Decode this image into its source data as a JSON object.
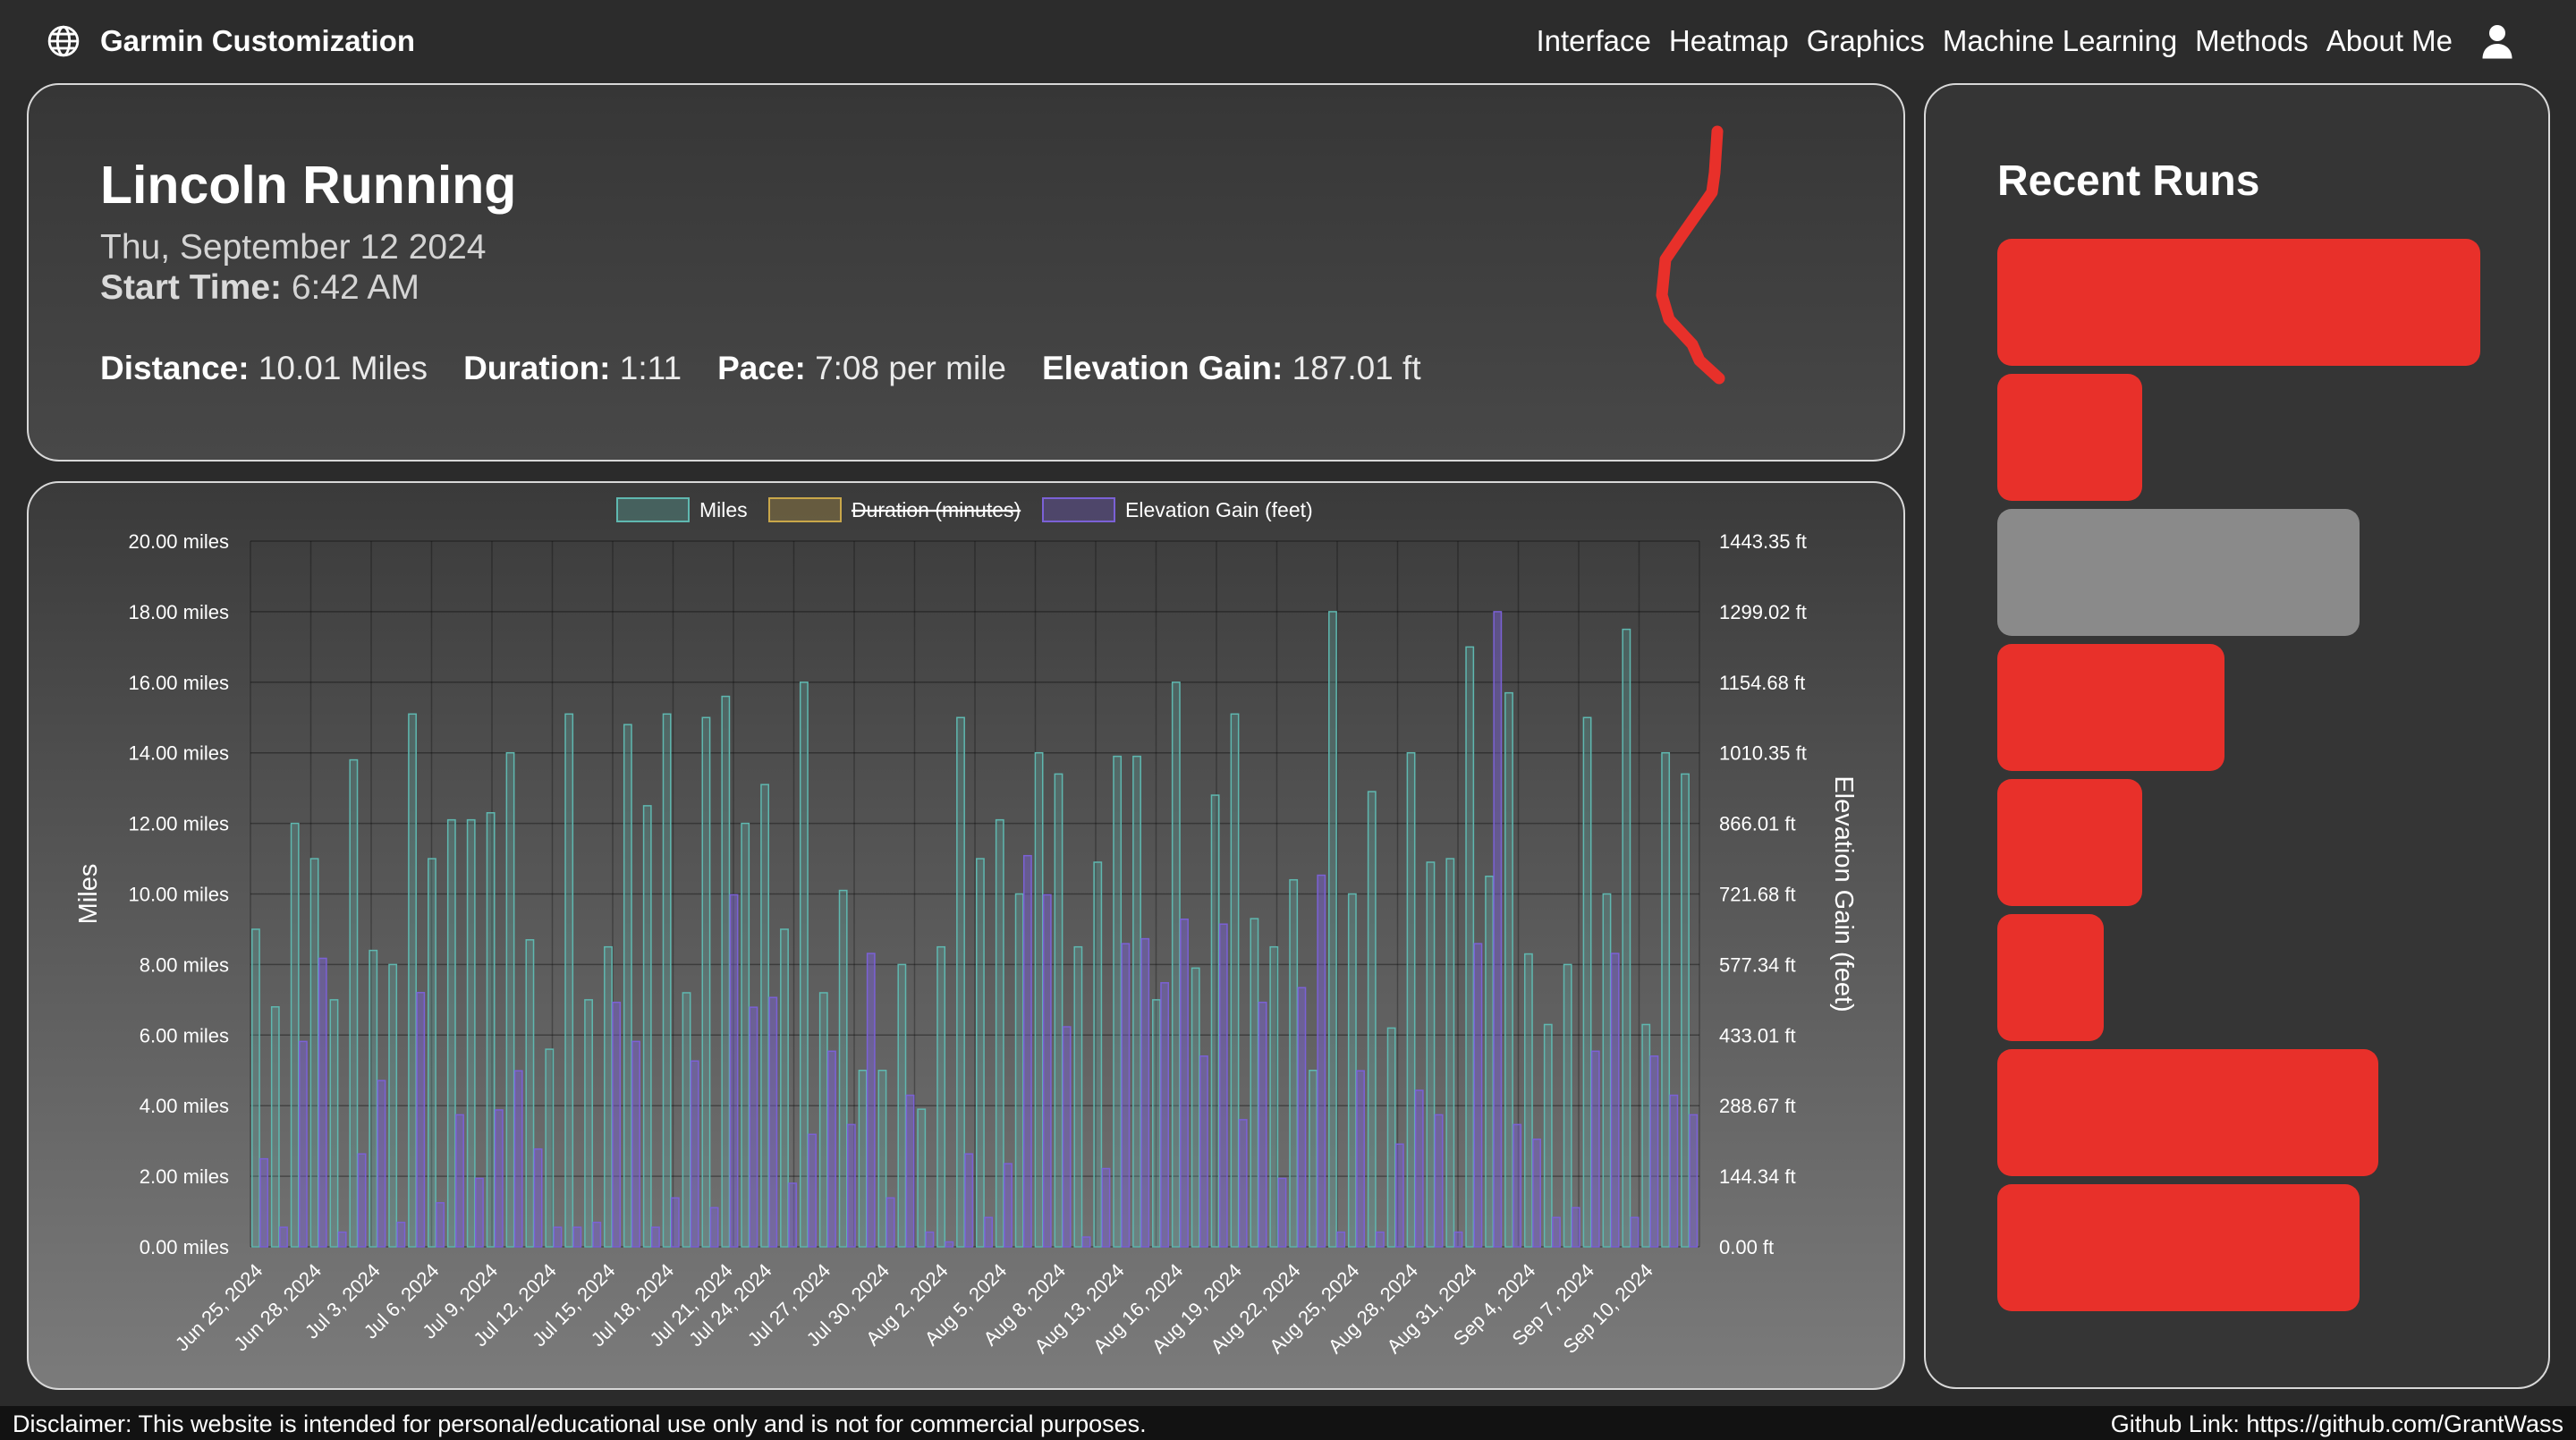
{
  "navbar": {
    "brand": "Garmin Customization",
    "links": [
      "Interface",
      "Heatmap",
      "Graphics",
      "Machine Learning",
      "Methods",
      "About Me"
    ]
  },
  "summary": {
    "title": "Lincoln Running",
    "date": "Thu, September 12 2024",
    "start_label": "Start Time:",
    "start_value": "6:42 AM",
    "distance_label": "Distance:",
    "distance_value": "10.01 Miles",
    "duration_label": "Duration:",
    "duration_value": "1:11",
    "pace_label": "Pace:",
    "pace_value": "7:08 per mile",
    "elev_label": "Elevation Gain:",
    "elev_value": "187.01 ft",
    "route_color": "#e8302a"
  },
  "recent_runs": {
    "title": "Recent Runs",
    "bars": [
      {
        "value": 10.01,
        "color": "#e8302a"
      },
      {
        "value": 3.0,
        "color": "#e8302a"
      },
      {
        "value": 7.5,
        "color": "#8a8a8a"
      },
      {
        "value": 4.7,
        "color": "#e8302a"
      },
      {
        "value": 3.0,
        "color": "#e8302a"
      },
      {
        "value": 2.2,
        "color": "#e8302a"
      },
      {
        "value": 7.9,
        "color": "#e8302a"
      },
      {
        "value": 7.5,
        "color": "#e8302a"
      }
    ]
  },
  "chart_data": {
    "type": "bar",
    "legend": [
      {
        "name": "Miles",
        "color": "#5fb8b0",
        "hidden": false
      },
      {
        "name": "Duration (minutes)",
        "color": "#c9a74a",
        "hidden": true
      },
      {
        "name": "Elevation Gain (feet)",
        "color": "#7b61d6",
        "hidden": false
      }
    ],
    "ylabel_left": "Miles",
    "ylabel_right": "Elevation Gain (feet)",
    "left_ticks": [
      "0.00 miles",
      "2.00 miles",
      "4.00 miles",
      "6.00 miles",
      "8.00 miles",
      "10.00 miles",
      "12.00 miles",
      "14.00 miles",
      "16.00 miles",
      "18.00 miles",
      "20.00 miles"
    ],
    "right_ticks": [
      "0.00 ft",
      "144.34 ft",
      "288.67 ft",
      "433.01 ft",
      "577.34 ft",
      "721.68 ft",
      "866.01 ft",
      "1010.35 ft",
      "1154.68 ft",
      "1299.02 ft",
      "1443.35 ft"
    ],
    "ylim_left": [
      0,
      20
    ],
    "ylim_right": [
      0,
      1443.35
    ],
    "x_labels": [
      "Jun 25, 2024",
      "Jun 28, 2024",
      "Jul 3, 2024",
      "Jul 6, 2024",
      "Jul 9, 2024",
      "Jul 12, 2024",
      "Jul 15, 2024",
      "Jul 18, 2024",
      "Jul 21, 2024",
      "Jul 24, 2024",
      "Jul 27, 2024",
      "Jul 30, 2024",
      "Aug 2, 2024",
      "Aug 5, 2024",
      "Aug 8, 2024",
      "Aug 13, 2024",
      "Aug 16, 2024",
      "Aug 19, 2024",
      "Aug 22, 2024",
      "Aug 25, 2024",
      "Aug 28, 2024",
      "Aug 31, 2024",
      "Sep 4, 2024",
      "Sep 7, 2024",
      "Sep 10, 2024"
    ],
    "miles": [
      9.0,
      6.8,
      12.0,
      11.0,
      7.0,
      13.8,
      8.4,
      8.0,
      15.1,
      11.0,
      12.1,
      12.1,
      12.3,
      14.0,
      8.7,
      5.6,
      15.1,
      7.0,
      8.5,
      14.8,
      12.5,
      15.1,
      7.2,
      15.0,
      15.6,
      12.0,
      13.1,
      9.0,
      16.0,
      7.2,
      10.1,
      5.0,
      5.0,
      8.0,
      3.9,
      8.5,
      15.0,
      11.0,
      12.1,
      10.0,
      14.0,
      13.4,
      8.5,
      10.9,
      13.9,
      13.9,
      7.0,
      16.0,
      7.9,
      12.8,
      15.1,
      9.3,
      8.5,
      10.4,
      5.0,
      18.0,
      10.0,
      12.9,
      6.2,
      14.0,
      10.9,
      11.0,
      17.0,
      10.5,
      15.7,
      8.3,
      6.3,
      8.0,
      15.0,
      10.0,
      17.5,
      6.3,
      14.0,
      13.4
    ],
    "elevation_ft": [
      180,
      40,
      420,
      590,
      30,
      190,
      340,
      50,
      520,
      90,
      270,
      140,
      280,
      360,
      200,
      40,
      40,
      50,
      500,
      420,
      40,
      100,
      380,
      80,
      720,
      490,
      510,
      130,
      230,
      400,
      250,
      600,
      100,
      310,
      30,
      10,
      190,
      60,
      170,
      800,
      720,
      450,
      20,
      160,
      620,
      630,
      540,
      670,
      390,
      660,
      260,
      500,
      140,
      530,
      760,
      30,
      360,
      30,
      210,
      320,
      270,
      30,
      620,
      1299,
      250,
      220,
      60,
      80,
      400,
      600,
      60,
      390,
      310,
      270,
      60
    ]
  },
  "footer": {
    "disclaimer": "Disclaimer: This website is intended for personal/educational use only and is not for commercial purposes.",
    "github_label": "Github Link:",
    "github_url": "https://github.com/GrantWass"
  }
}
